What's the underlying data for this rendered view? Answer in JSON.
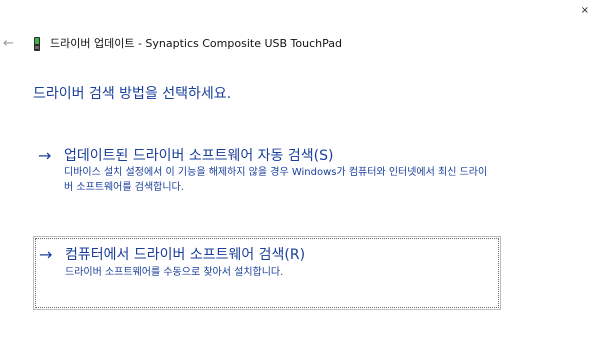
{
  "window": {
    "title": "드라이버 업데이트 - Synaptics Composite USB TouchPad",
    "back_glyph": "←",
    "close_glyph": "×"
  },
  "icons": {
    "back": "back-arrow-icon",
    "device": "device-driver-icon",
    "option_arrow": "right-arrow-icon"
  },
  "instruction": "드라이버 검색 방법을 선택하세요.",
  "options": [
    {
      "arrow": "→",
      "title": "업데이트된 드라이버 소프트웨어 자동 검색(S)",
      "description": "디바이스 설치 설정에서 이 기능을 해제하지 않을 경우 Windows가 컴퓨터와 인터넷에서 최신 드라이버 소프트웨어를 검색합니다."
    },
    {
      "arrow": "→",
      "title": "컴퓨터에서 드라이버 소프트웨어 검색(R)",
      "description": "드라이버 소프트웨어를 수동으로 찾아서 설치합니다."
    }
  ],
  "colors": {
    "link_blue": "#1a3f9b",
    "focus_border": "#bcbcbc"
  }
}
